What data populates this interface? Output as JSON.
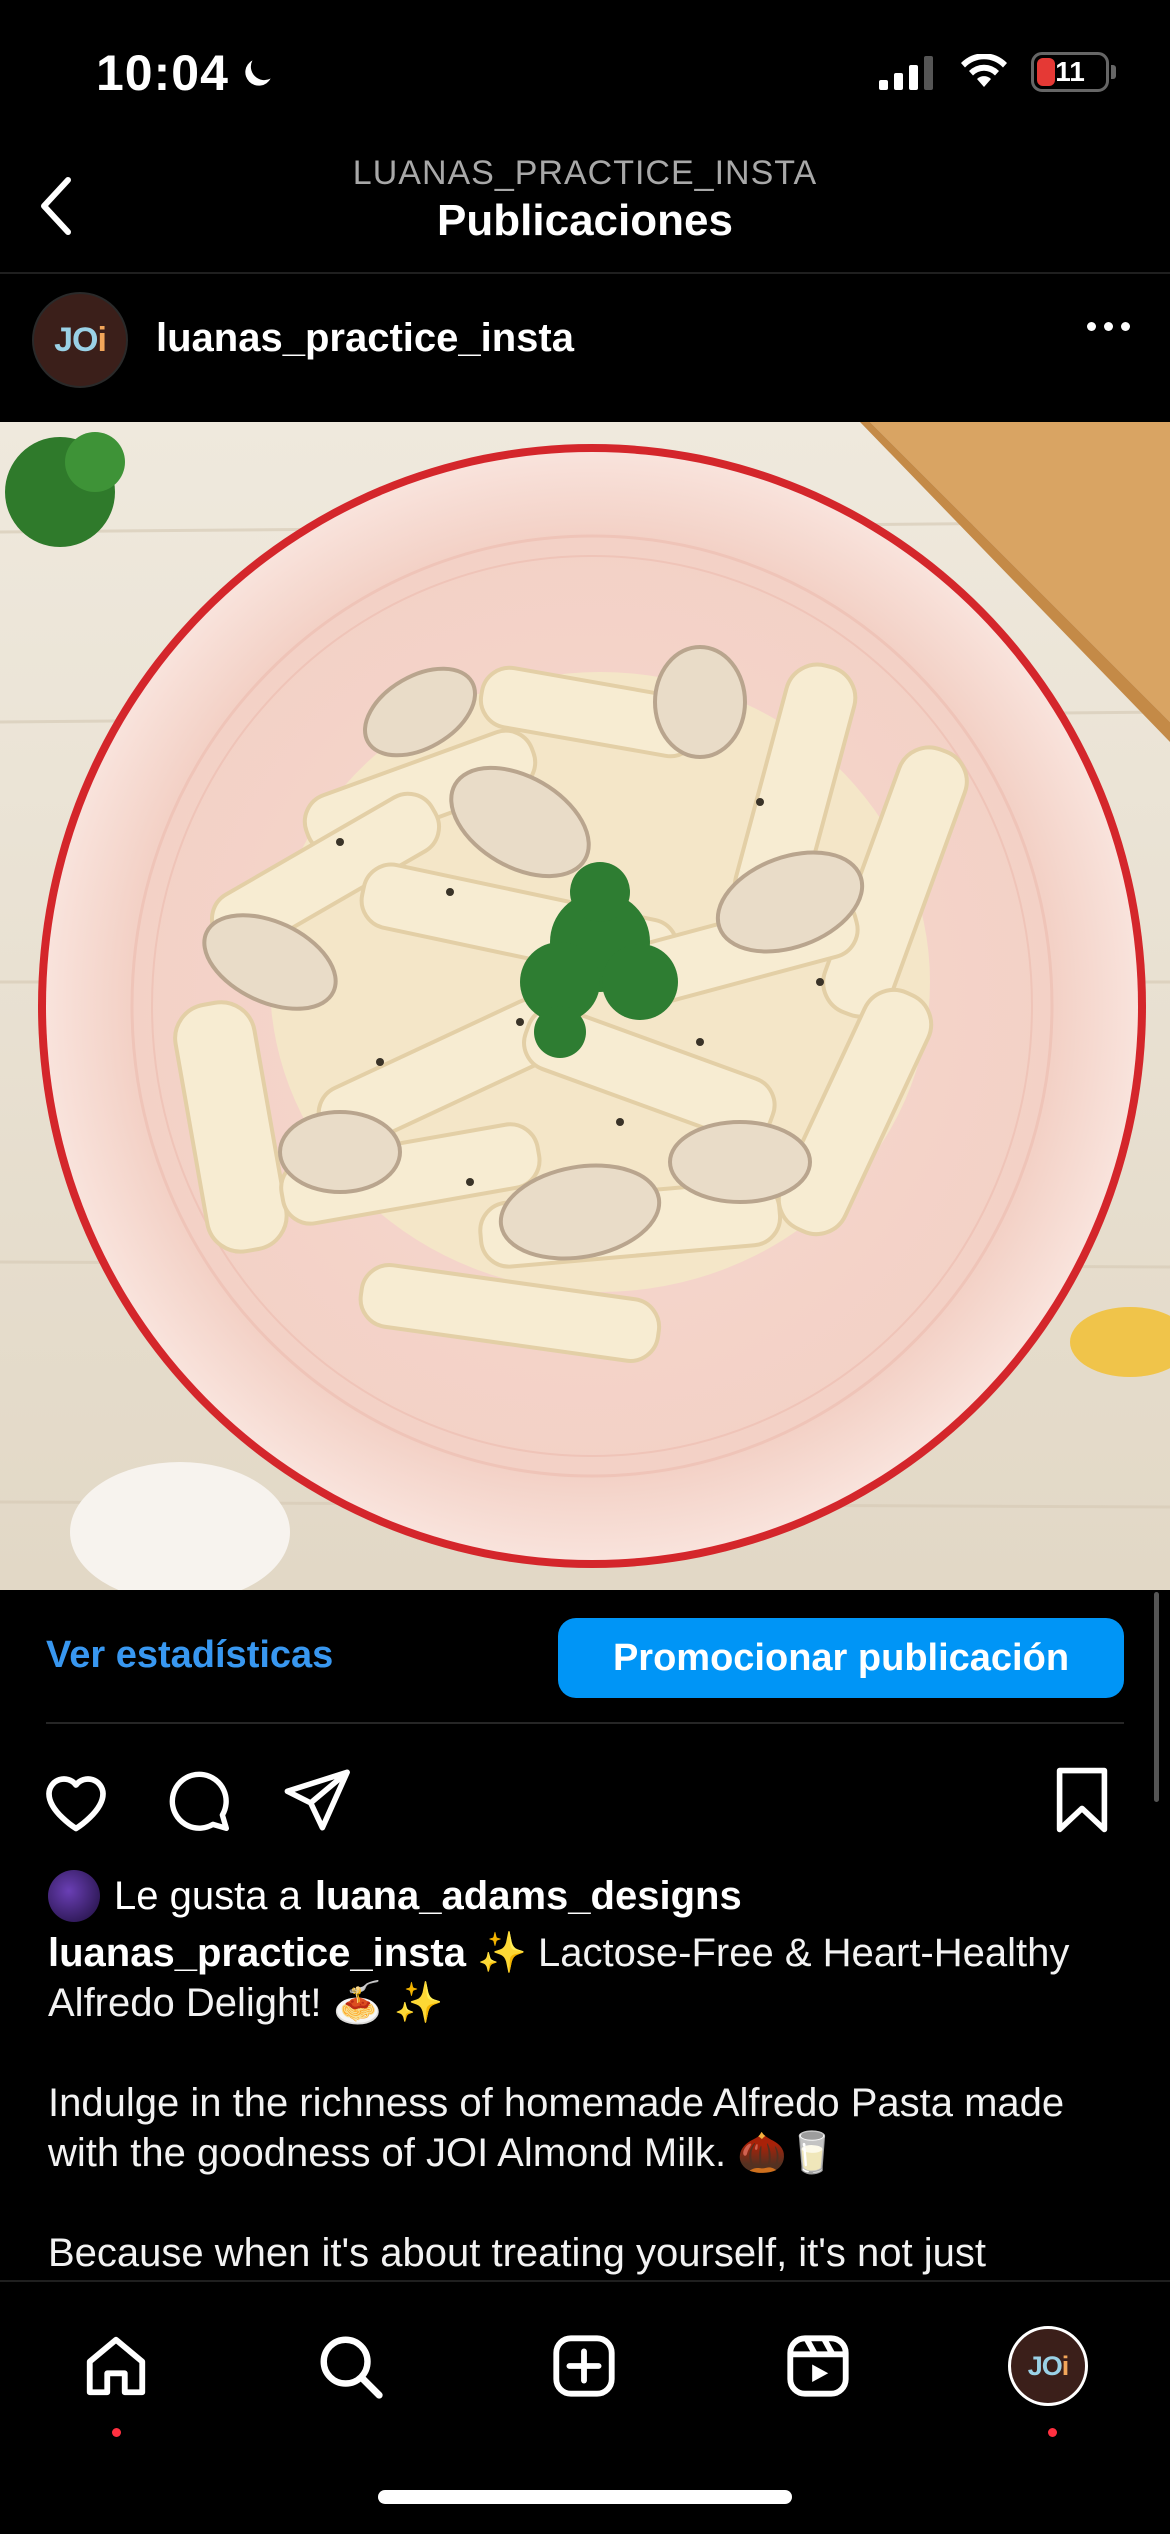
{
  "status_bar": {
    "time": "10:04",
    "battery": "11",
    "moon_icon": "moon-icon",
    "signal_icon": "cellular-signal-icon",
    "wifi_icon": "wifi-icon"
  },
  "header": {
    "subtitle": "LUANAS_PRACTICE_INSTA",
    "title": "Publicaciones",
    "back_icon": "chevron-left-icon"
  },
  "post": {
    "username": "luanas_practice_insta",
    "avatar_text_a": "JO",
    "avatar_text_b": "i",
    "image_description_icon": "food-photo"
  },
  "insights": {
    "view_stats_label": "Ver estadísticas",
    "promote_label": "Promocionar publicación"
  },
  "likes": {
    "prefix": "Le gusta a",
    "user": "luana_adams_designs"
  },
  "caption": {
    "username": "luanas_practice_insta",
    "line1": "✨ Lactose-Free & Heart-Healthy Alfredo Delight! 🍝 ✨",
    "paragraph2": "Indulge in the richness of homemade Alfredo Pasta made with the goodness of JOI Almond Milk. 🌰🥛",
    "paragraph3": "Because when it's about treating yourself, it's not just"
  },
  "nav": {
    "items": [
      "home-icon",
      "search-icon",
      "create-icon",
      "reels-icon",
      "profile-avatar"
    ],
    "profile_text_a": "JO",
    "profile_text_b": "i"
  },
  "colors": {
    "accent": "#0095f6",
    "link": "#3897f0",
    "notification": "#ff3040",
    "battery_low": "#e53935"
  }
}
